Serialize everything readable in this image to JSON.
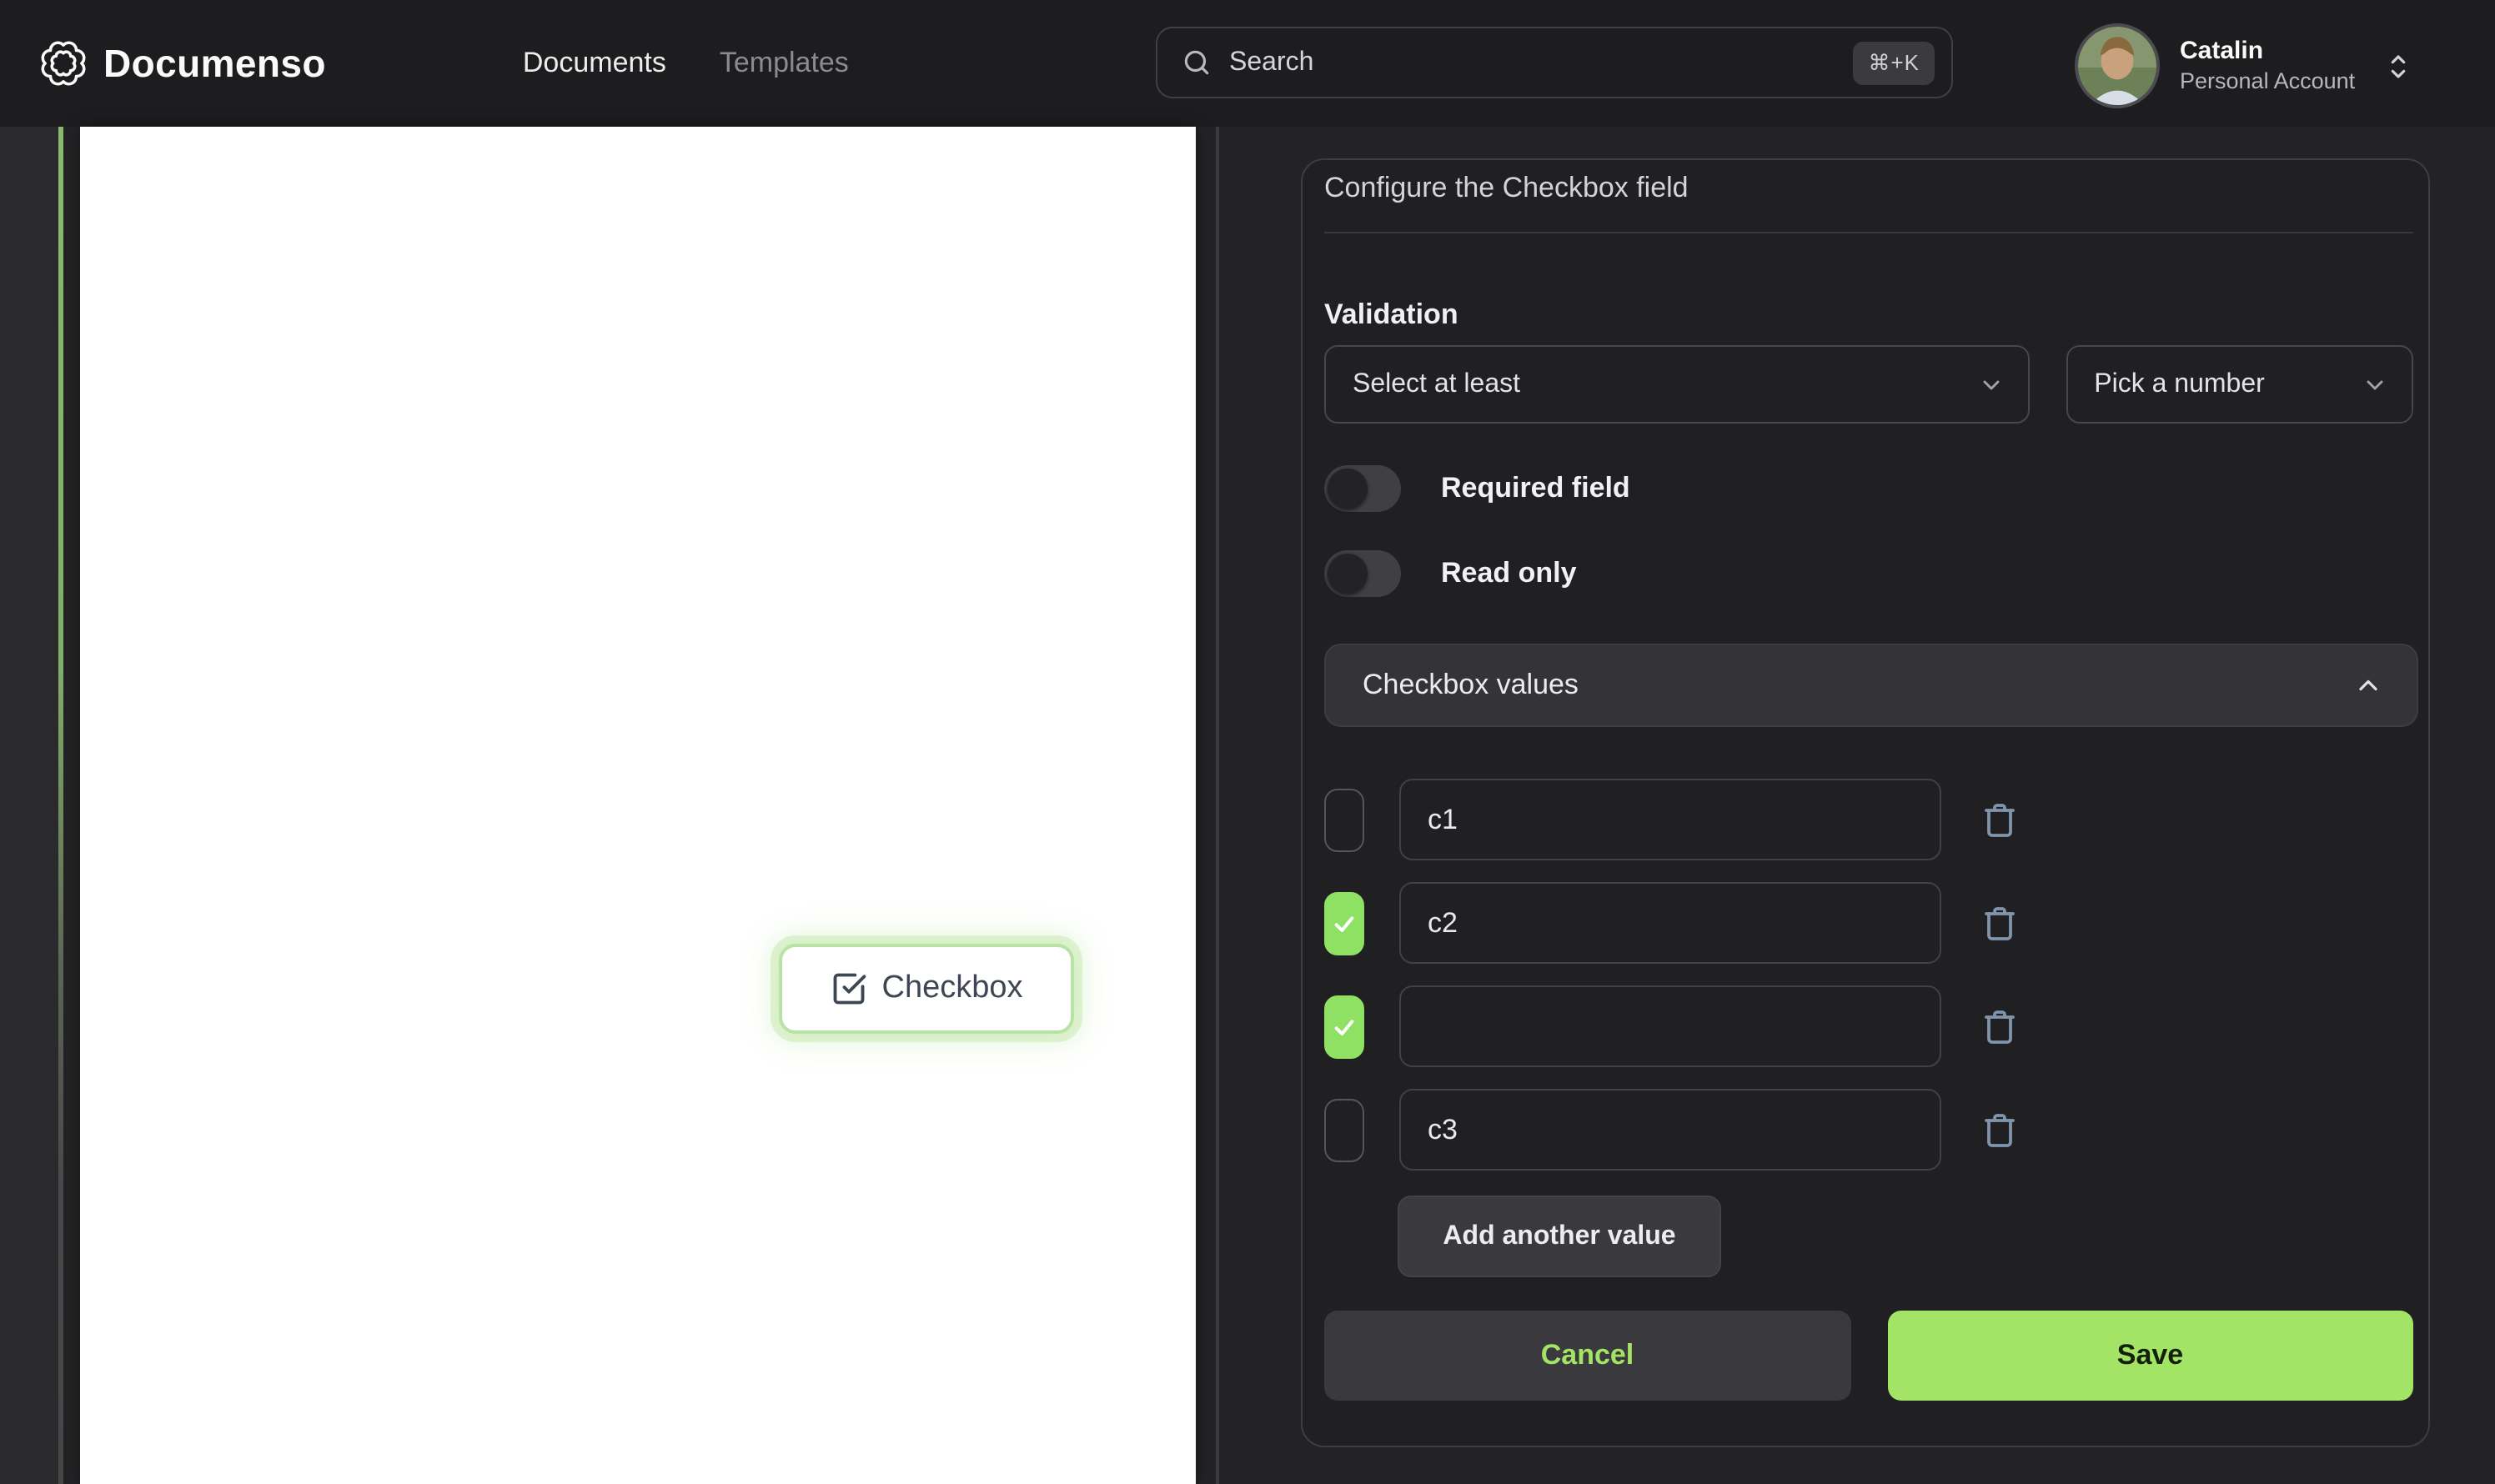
{
  "nav": {
    "brand": "Documenso",
    "links": [
      {
        "label": "Documents",
        "active": true
      },
      {
        "label": "Templates",
        "active": false
      }
    ],
    "search": {
      "placeholder": "Search",
      "shortcut": "⌘+K"
    },
    "user": {
      "name": "Catalin",
      "account_type": "Personal Account"
    }
  },
  "document": {
    "field": {
      "type": "checkbox",
      "label": "Checkbox"
    }
  },
  "panel": {
    "title": "Configure the Checkbox field",
    "validation": {
      "label": "Validation",
      "rule_select": {
        "value": "Select at least"
      },
      "number_select": {
        "value": "Pick a number"
      }
    },
    "toggles": [
      {
        "label": "Required field",
        "on": false
      },
      {
        "label": "Read only",
        "on": false
      }
    ],
    "values_section": {
      "header": "Checkbox values",
      "rows": [
        {
          "checked": false,
          "value": "c1"
        },
        {
          "checked": true,
          "value": "c2"
        },
        {
          "checked": true,
          "value": ""
        },
        {
          "checked": false,
          "value": "c3"
        }
      ],
      "add_button": "Add another value"
    },
    "actions": {
      "cancel": "Cancel",
      "save": "Save"
    }
  },
  "colors": {
    "accent_green": "#a3e466",
    "checkbox_green": "#8fe163",
    "field_border_green": "#b9e3a6",
    "trash_icon": "#8094ac",
    "navbar_bg": "#1d1d1f",
    "panel_bg": "#202022"
  }
}
